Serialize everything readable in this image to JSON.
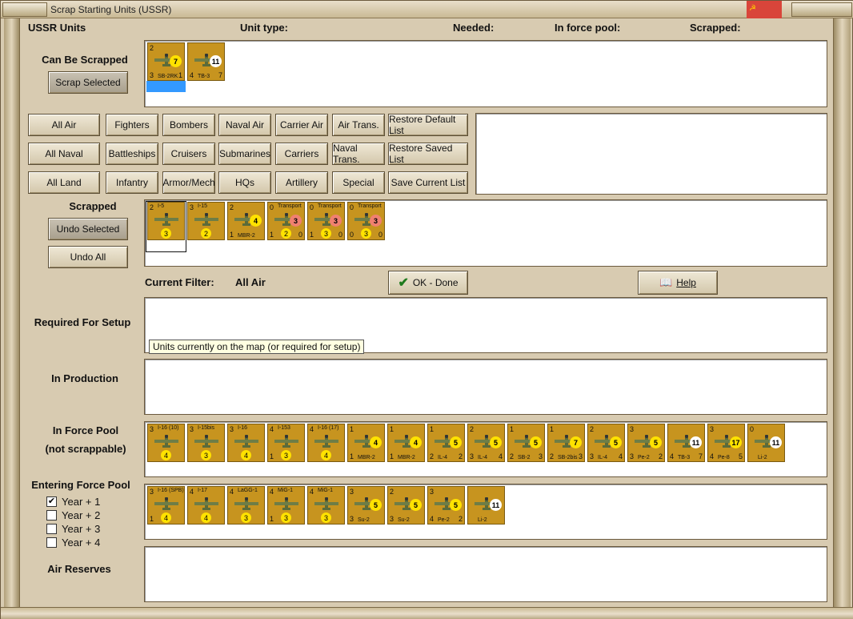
{
  "window": {
    "title": "Scrap Starting Units (USSR)"
  },
  "header": {
    "units": "USSR Units",
    "unit_type": "Unit type:",
    "needed": "Needed:",
    "in_force_pool": "In force pool:",
    "scrapped": "Scrapped:"
  },
  "can_be_scrapped": {
    "label": "Can Be Scrapped",
    "button": "Scrap Selected",
    "units": [
      {
        "name": "SB-2RK",
        "tl": "2",
        "bl": "3",
        "br": "1",
        "badge": "7",
        "badge_color": "#ffe200"
      },
      {
        "name": "TB-3",
        "tl": "",
        "bl": "4",
        "br": "7",
        "badge": "11",
        "badge_color": "#ffffff"
      }
    ]
  },
  "filters": {
    "row1": [
      "All Air",
      "Fighters",
      "Bombers",
      "Naval Air",
      "Carrier Air",
      "Air Trans.",
      "Restore Default List"
    ],
    "row2": [
      "All Naval",
      "Battleships",
      "Cruisers",
      "Submarines",
      "Carriers",
      "Naval Trans.",
      "Restore Saved List"
    ],
    "row3": [
      "All Land",
      "Infantry",
      "Armor/Mech",
      "HQs",
      "Artillery",
      "Special",
      "Save Current List"
    ]
  },
  "scrapped": {
    "label": "Scrapped",
    "undo_selected": "Undo Selected",
    "undo_all": "Undo All",
    "units": [
      {
        "name": "I-5",
        "tl": "2",
        "bl": "",
        "br": "",
        "bbadge": "3",
        "badge": "",
        "badge_color": ""
      },
      {
        "name": "I-15",
        "tl": "3",
        "bl": "",
        "br": "",
        "bbadge": "2",
        "badge": "",
        "badge_color": ""
      },
      {
        "name": "MBR-2",
        "tl": "2",
        "bl": "1",
        "br": "",
        "bbadge": "",
        "badge": "4",
        "badge_color": "#ffe200"
      },
      {
        "name": "Transport",
        "tl": "0",
        "bl": "1",
        "br": "0",
        "bbadge": "2",
        "badge": "3",
        "badge_color": "#f08070"
      },
      {
        "name": "Transport",
        "tl": "0",
        "bl": "1",
        "br": "0",
        "bbadge": "3",
        "badge": "3",
        "badge_color": "#f08070"
      },
      {
        "name": "Transport",
        "tl": "0",
        "bl": "0",
        "br": "0",
        "bbadge": "3",
        "badge": "3",
        "badge_color": "#f08070"
      }
    ]
  },
  "current_filter": {
    "label": "Current Filter:",
    "value": "All Air"
  },
  "ok_button": "OK - Done",
  "help_button": "Help",
  "required_for_setup": {
    "label": "Required For Setup"
  },
  "tooltip": "Units currently on the map (or required for setup)",
  "in_production": {
    "label": "In Production"
  },
  "in_force_pool": {
    "label_line1": "In Force Pool",
    "label_line2": "(not scrappable)",
    "units": [
      {
        "name": "I-16 (10)",
        "tl": "3",
        "bl": "",
        "br": "",
        "bbadge": "4",
        "badge": "",
        "badge_color": ""
      },
      {
        "name": "I-15bis",
        "tl": "3",
        "bl": "",
        "br": "",
        "bbadge": "3",
        "badge": "",
        "badge_color": ""
      },
      {
        "name": "I-16",
        "tl": "3",
        "bl": "",
        "br": "",
        "bbadge": "4",
        "badge": "",
        "badge_color": ""
      },
      {
        "name": "I-153",
        "tl": "4",
        "bl": "1",
        "br": "",
        "bbadge": "3",
        "badge": "",
        "badge_color": ""
      },
      {
        "name": "I-16 (17)",
        "tl": "4",
        "bl": "",
        "br": "",
        "bbadge": "4",
        "badge": "",
        "badge_color": ""
      },
      {
        "name": "MBR-2",
        "tl": "1",
        "bl": "1",
        "br": "",
        "bbadge": "",
        "badge": "4",
        "badge_color": "#ffe200"
      },
      {
        "name": "MBR-2",
        "tl": "1",
        "bl": "1",
        "br": "",
        "bbadge": "",
        "badge": "4",
        "badge_color": "#ffe200"
      },
      {
        "name": "IL-4",
        "tl": "1",
        "bl": "2",
        "br": "2",
        "bbadge": "",
        "badge": "5",
        "badge_color": "#ffe200"
      },
      {
        "name": "IL-4",
        "tl": "2",
        "bl": "3",
        "br": "4",
        "bbadge": "",
        "badge": "5",
        "badge_color": "#ffe200"
      },
      {
        "name": "SB-2",
        "tl": "1",
        "bl": "2",
        "br": "3",
        "bbadge": "",
        "badge": "5",
        "badge_color": "#ffe200"
      },
      {
        "name": "SB-2bis",
        "tl": "1",
        "bl": "2",
        "br": "3",
        "bbadge": "",
        "badge": "7",
        "badge_color": "#ffe200"
      },
      {
        "name": "IL-4",
        "tl": "2",
        "bl": "3",
        "br": "4",
        "bbadge": "",
        "badge": "5",
        "badge_color": "#ffe200"
      },
      {
        "name": "Pe-2",
        "tl": "3",
        "bl": "3",
        "br": "2",
        "bbadge": "",
        "badge": "5",
        "badge_color": "#ffe200"
      },
      {
        "name": "TB-3",
        "tl": "",
        "bl": "4",
        "br": "7",
        "bbadge": "",
        "badge": "11",
        "badge_color": "#ffffff"
      },
      {
        "name": "Pe-8",
        "tl": "3",
        "bl": "4",
        "br": "5",
        "bbadge": "",
        "badge": "17",
        "badge_color": "#ffe200"
      },
      {
        "name": "Li-2",
        "tl": "0",
        "bl": "",
        "br": "",
        "bbadge": "",
        "badge": "11",
        "badge_color": "#ffffff"
      }
    ]
  },
  "entering_force_pool": {
    "label": "Entering Force Pool",
    "years": [
      {
        "label": "Year + 1",
        "checked": true
      },
      {
        "label": "Year + 2",
        "checked": false
      },
      {
        "label": "Year + 3",
        "checked": false
      },
      {
        "label": "Year + 4",
        "checked": false
      }
    ],
    "units": [
      {
        "name": "I-16 (SPB)",
        "tl": "3",
        "bl": "1",
        "br": "",
        "bbadge": "4",
        "badge": "",
        "badge_color": ""
      },
      {
        "name": "I-17",
        "tl": "4",
        "bl": "",
        "br": "",
        "bbadge": "4",
        "badge": "",
        "badge_color": ""
      },
      {
        "name": "LaGG-1",
        "tl": "4",
        "bl": "",
        "br": "",
        "bbadge": "3",
        "badge": "",
        "badge_color": ""
      },
      {
        "name": "MiG-1",
        "tl": "4",
        "bl": "1",
        "br": "",
        "bbadge": "3",
        "badge": "",
        "badge_color": ""
      },
      {
        "name": "MiG-1",
        "tl": "4",
        "bl": "",
        "br": "",
        "bbadge": "3",
        "badge": "",
        "badge_color": ""
      },
      {
        "name": "Su-2",
        "tl": "3",
        "bl": "3",
        "br": "",
        "bbadge": "",
        "badge": "5",
        "badge_color": "#ffe200"
      },
      {
        "name": "Su-2",
        "tl": "2",
        "bl": "3",
        "br": "",
        "bbadge": "",
        "badge": "5",
        "badge_color": "#ffe200"
      },
      {
        "name": "Pe-2",
        "tl": "3",
        "bl": "4",
        "br": "2",
        "bbadge": "",
        "badge": "5",
        "badge_color": "#ffe200"
      },
      {
        "name": "Li-2",
        "tl": "",
        "bl": "",
        "br": "",
        "bbadge": "",
        "badge": "11",
        "badge_color": "#ffffff"
      }
    ]
  },
  "air_reserves": {
    "label": "Air Reserves"
  }
}
